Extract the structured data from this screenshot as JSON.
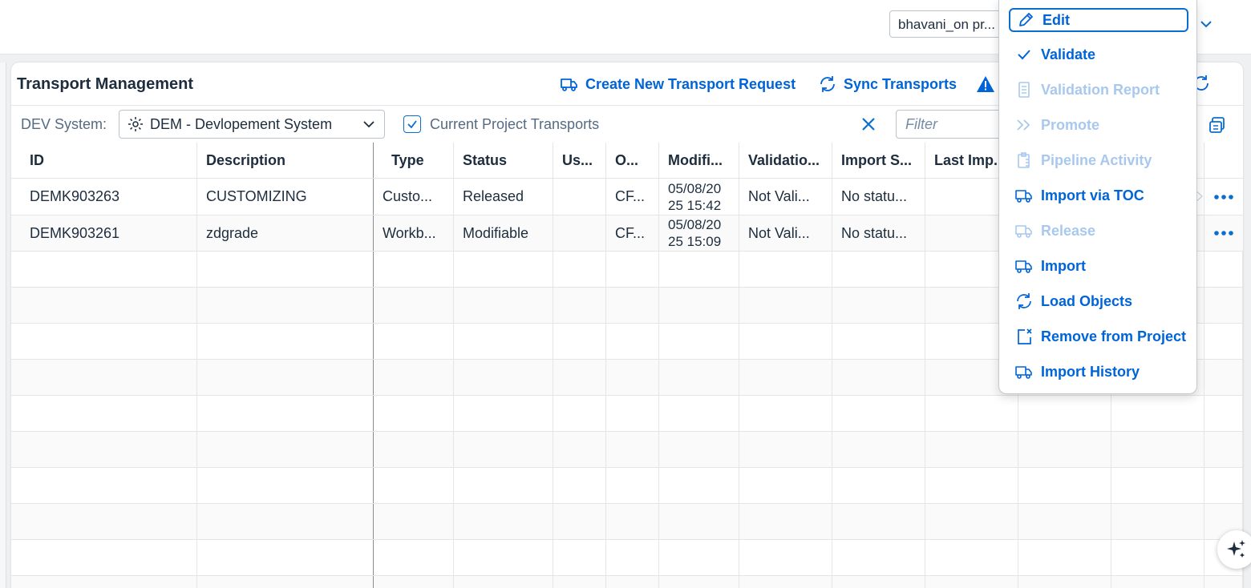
{
  "shell": {
    "project_value": "bhavani_on pr..."
  },
  "toolbar": {
    "title": "Transport Management",
    "create_label": "Create New Transport Request",
    "sync_label": "Sync Transports"
  },
  "filterbar": {
    "dev_label": "DEV System:",
    "dev_value": "DEM - Devlopement System",
    "current_project_label": "Current Project Transports",
    "current_project_checked": true,
    "filter_placeholder": "Filter"
  },
  "table": {
    "headers": [
      "ID",
      "Description",
      "Type",
      "Status",
      "Us...",
      "O...",
      "Modifi...",
      "Validatio...",
      "Import S...",
      "Last Imp..."
    ],
    "rows": [
      {
        "id": "DEMK903263",
        "description": "CUSTOMIZING",
        "type": "Custo...",
        "status": "Released",
        "user": "",
        "owner": "CF...",
        "modified": "05/08/20 25 15:42",
        "validation": "Not Vali...",
        "import_status": "No statu...",
        "last_import": ""
      },
      {
        "id": "DEMK903261",
        "description": "zdgrade",
        "type": "Workb...",
        "status": "Modifiable",
        "user": "",
        "owner": "CF...",
        "modified": "05/08/20 25 15:09",
        "validation": "Not Vali...",
        "import_status": "No statu...",
        "last_import": ""
      }
    ]
  },
  "menu": {
    "items": [
      {
        "label": "Edit",
        "icon": "pencil-icon",
        "enabled": true,
        "focused": true
      },
      {
        "label": "Validate",
        "icon": "checkmark-icon",
        "enabled": true
      },
      {
        "label": "Validation Report",
        "icon": "document-icon",
        "enabled": false
      },
      {
        "label": "Promote",
        "icon": "double-chevron-right-icon",
        "enabled": false
      },
      {
        "label": "Pipeline Activity",
        "icon": "clipboard-icon",
        "enabled": false
      },
      {
        "label": "Import via TOC",
        "icon": "truck-icon",
        "enabled": true
      },
      {
        "label": "Release",
        "icon": "truck-icon",
        "enabled": false
      },
      {
        "label": "Import",
        "icon": "truck-icon",
        "enabled": true
      },
      {
        "label": "Load Objects",
        "icon": "refresh-icon",
        "enabled": true
      },
      {
        "label": "Remove from Project",
        "icon": "remove-icon",
        "enabled": true
      },
      {
        "label": "Import History",
        "icon": "truck-icon",
        "enabled": true
      }
    ]
  },
  "colors": {
    "accent": "#0064d9",
    "disabled": "#a8c8ee",
    "text": "#1d2d3e",
    "muted": "#556b82"
  }
}
